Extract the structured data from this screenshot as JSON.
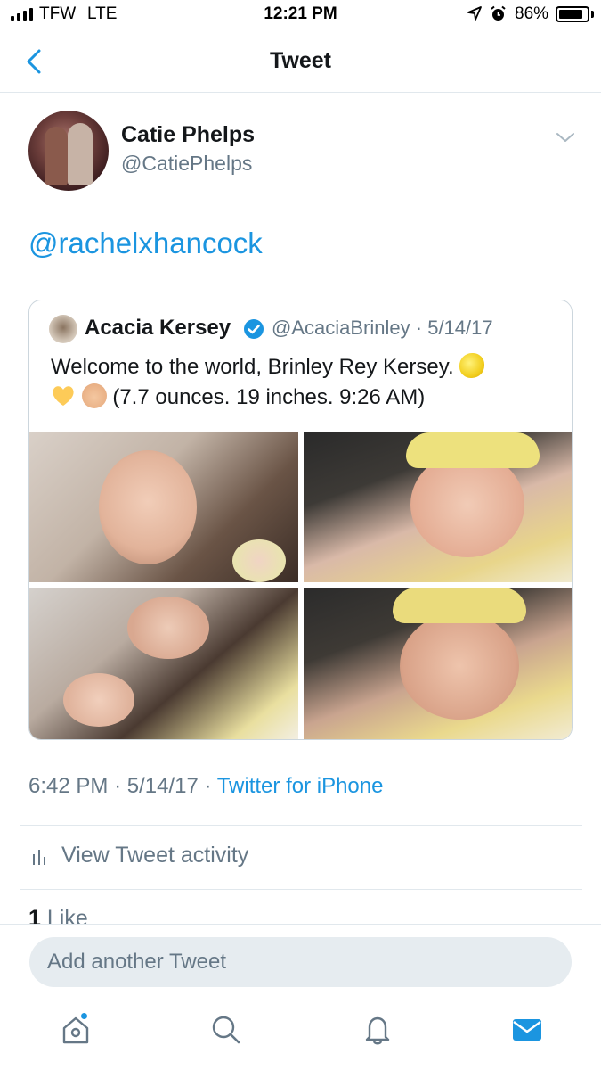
{
  "status_bar": {
    "carrier": "TFW",
    "network": "LTE",
    "time": "12:21 PM",
    "battery": "86%",
    "battery_level": 0.86,
    "icons": [
      "signal-icon",
      "location-icon",
      "alarm-icon",
      "battery-icon"
    ]
  },
  "nav": {
    "title": "Tweet",
    "back_icon": "chevron-left-icon"
  },
  "tweet": {
    "author_name": "Catie Phelps",
    "author_handle": "@CatiePhelps",
    "text": "@rachelxhancock",
    "quoted": {
      "name": "Acacia Kersey",
      "verified": true,
      "handle": "@AcaciaBrinley",
      "date": "5/14/17",
      "text_line1": "Welcome to the world, Brinley Rey Kersey.",
      "text_line2": "(7.7 ounces. 19 inches. 9:26 AM)",
      "emoji": [
        "lemon",
        "yellow-heart",
        "baby"
      ],
      "image_count": 4
    },
    "time": "6:42 PM",
    "date": "5/14/17",
    "source": "Twitter for iPhone",
    "activity_label": "View Tweet activity",
    "like_count": "1",
    "like_label": "Like"
  },
  "compose": {
    "placeholder": "Add another Tweet"
  },
  "tabs": [
    {
      "name": "home",
      "icon": "home-icon",
      "has_dot": true
    },
    {
      "name": "search",
      "icon": "search-icon"
    },
    {
      "name": "notifications",
      "icon": "bell-icon"
    },
    {
      "name": "messages",
      "icon": "mail-icon",
      "active": true
    }
  ],
  "colors": {
    "accent": "#1b95e0",
    "secondary_text": "#657786",
    "primary_text": "#14171a",
    "input_bg": "#e6ecf0"
  }
}
